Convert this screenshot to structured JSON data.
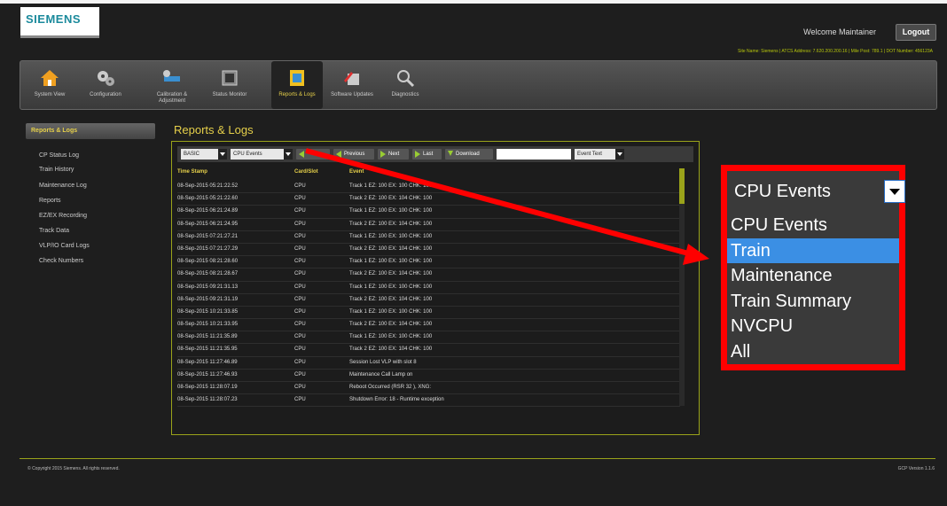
{
  "header": {
    "brand": "SIEMENS",
    "welcome": "Welcome Maintainer",
    "logout_label": "Logout",
    "site_info": "Site Name: Siemens | ATCS Address: 7.620.200.200.16 | Mile Post: 789.1 | DOT Number: 456123A"
  },
  "nav": [
    {
      "label": "System View",
      "icon": "house-icon"
    },
    {
      "label": "Configuration",
      "icon": "gears-icon"
    },
    {
      "label": "Calibration & Adjustment",
      "icon": "tools-icon"
    },
    {
      "label": "Status Monitor",
      "icon": "monitor-icon"
    },
    {
      "label": "Reports & Logs",
      "icon": "report-icon"
    },
    {
      "label": "Software Updates",
      "icon": "software-icon"
    },
    {
      "label": "Diagnostics",
      "icon": "diagnostics-icon"
    }
  ],
  "sidebar": {
    "header": "Reports & Logs",
    "items": [
      "CP Status Log",
      "Train History",
      "Maintenance Log",
      "Reports",
      "EZ/EX Recording",
      "Track Data",
      "VLP/IO Card Logs",
      "Check Numbers"
    ]
  },
  "main": {
    "title": "Reports & Logs",
    "toolbar": {
      "mode": "BASIC",
      "event_type": "CPU Events",
      "previous": "Previous",
      "next": "Next",
      "last": "Last",
      "download": "Download",
      "search_value": "",
      "filter": "Event Text"
    },
    "columns": [
      "Time Stamp",
      "Card/Slot",
      "Event"
    ],
    "rows": [
      [
        "08-Sep-2015 05:21:22.52",
        "CPU",
        "Track 1 EZ: 100 EX: 100 CHK: 100"
      ],
      [
        "08-Sep-2015 05:21:22.60",
        "CPU",
        "Track 2 EZ: 100 EX: 104 CHK: 100"
      ],
      [
        "08-Sep-2015 06:21:24.89",
        "CPU",
        "Track 1 EZ: 100 EX: 100 CHK: 100"
      ],
      [
        "08-Sep-2015 06:21:24.95",
        "CPU",
        "Track 2 EZ: 100 EX: 104 CHK: 100"
      ],
      [
        "08-Sep-2015 07:21:27.21",
        "CPU",
        "Track 1 EZ: 100 EX: 100 CHK: 100"
      ],
      [
        "08-Sep-2015 07:21:27.29",
        "CPU",
        "Track 2 EZ: 100 EX: 104 CHK: 100"
      ],
      [
        "08-Sep-2015 08:21:28.60",
        "CPU",
        "Track 1 EZ: 100 EX: 100 CHK: 100"
      ],
      [
        "08-Sep-2015 08:21:28.67",
        "CPU",
        "Track 2 EZ: 100 EX: 104 CHK: 100"
      ],
      [
        "08-Sep-2015 09:21:31.13",
        "CPU",
        "Track 1 EZ: 100 EX: 100 CHK: 100"
      ],
      [
        "08-Sep-2015 09:21:31.19",
        "CPU",
        "Track 2 EZ: 100 EX: 104 CHK: 100"
      ],
      [
        "08-Sep-2015 10:21:33.85",
        "CPU",
        "Track 1 EZ: 100 EX: 100 CHK: 100"
      ],
      [
        "08-Sep-2015 10:21:33.95",
        "CPU",
        "Track 2 EZ: 100 EX: 104 CHK: 100"
      ],
      [
        "08-Sep-2015 11:21:35.89",
        "CPU",
        "Track 1 EZ: 100 EX: 100 CHK: 100"
      ],
      [
        "08-Sep-2015 11:21:35.95",
        "CPU",
        "Track 2 EZ: 100 EX: 104 CHK: 100"
      ],
      [
        "08-Sep-2015 11:27:46.89",
        "CPU",
        "Session Lost VLP with slot 8"
      ],
      [
        "08-Sep-2015 11:27:46.93",
        "CPU",
        "Maintenance Call Lamp on"
      ],
      [
        "08-Sep-2015 11:28:07.19",
        "CPU",
        "Reboot Occurred (RSR 32 ), XNG:"
      ],
      [
        "08-Sep-2015 11:28:07.23",
        "CPU",
        "Shutdown Error: 18 - Runtime exception"
      ]
    ]
  },
  "callout": {
    "selected": "CPU Events",
    "options": [
      "CPU Events",
      "Train",
      "Maintenance",
      "Train Summary",
      "NVCPU",
      "All"
    ],
    "highlighted_index": 1,
    "frame_color": "#ff0000",
    "highlight_color": "#3b8fe4"
  },
  "footer": {
    "copyright": "© Copyright 2015 Siemens. All rights reserved.",
    "version": "GCP Version 1.1.6"
  },
  "colors": {
    "accent": "#e6d04a",
    "border": "#9aa31a",
    "annotation": "#ff0000"
  }
}
